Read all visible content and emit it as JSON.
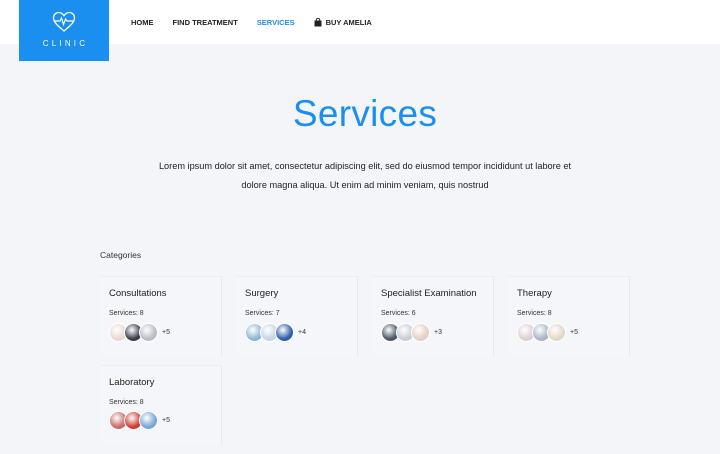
{
  "logo": {
    "text": "CLINIC"
  },
  "nav": [
    {
      "label": "HOME",
      "active": false
    },
    {
      "label": "FIND TREATMENT",
      "active": false
    },
    {
      "label": "SERVICES",
      "active": true
    },
    {
      "label": "BUY AMELIA",
      "active": false
    }
  ],
  "hero": {
    "title": "Services",
    "text": "Lorem ipsum dolor sit amet, consectetur adipiscing elit, sed do eiusmod tempor incididunt ut labore et dolore magna aliqua. Ut enim ad minim veniam, quis nostrud"
  },
  "categories": {
    "label": "Categories",
    "items": [
      {
        "name": "Consultations",
        "count": "Services: 8",
        "more": "+5",
        "avatar_colors": [
          "#e9d6d2",
          "#3a3f4b",
          "#b8bcc6"
        ]
      },
      {
        "name": "Surgery",
        "count": "Services: 7",
        "more": "+4",
        "avatar_colors": [
          "#8fb5d6",
          "#c5d6e4",
          "#2f5fa8"
        ]
      },
      {
        "name": "Specialist Examination",
        "count": "Services: 6",
        "more": "+3",
        "avatar_colors": [
          "#4b5566",
          "#c9ccd2",
          "#e4cfc4"
        ]
      },
      {
        "name": "Therapy",
        "count": "Services: 8",
        "more": "+5",
        "avatar_colors": [
          "#dccfd0",
          "#a9b5c6",
          "#e2d6c8"
        ]
      },
      {
        "name": "Laboratory",
        "count": "Services: 8",
        "more": "+5",
        "avatar_colors": [
          "#c96a66",
          "#cf3d34",
          "#7aa7d2"
        ]
      }
    ]
  },
  "colors": {
    "accent": "#1a8ff0",
    "background": "#f4f5f8"
  }
}
